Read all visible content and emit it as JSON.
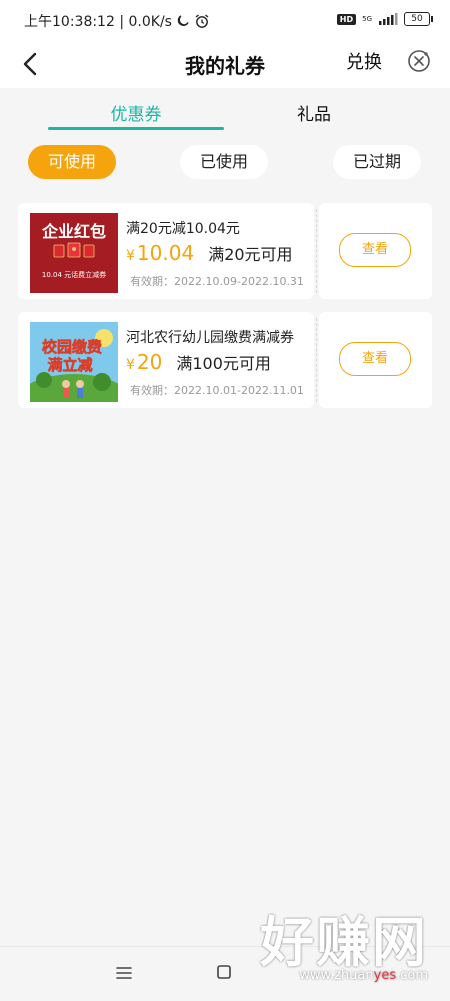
{
  "status_bar": {
    "time_speed": "上午10:38:12 | 0.0K/s",
    "hd": "HD",
    "network": "5G",
    "battery": "50"
  },
  "header": {
    "title": "我的礼券",
    "exchange_label": "兑换"
  },
  "tabs": [
    {
      "label": "优惠券",
      "active": true
    },
    {
      "label": "礼品",
      "active": false
    }
  ],
  "filters": [
    {
      "label": "可使用",
      "active": true
    },
    {
      "label": "已使用",
      "active": false
    },
    {
      "label": "已过期",
      "active": false
    }
  ],
  "coupons": [
    {
      "title": "满20元减10.04元",
      "currency": "¥",
      "amount": "10.04",
      "condition": "满20元可用",
      "validity": "有效期：2022.10.09-2022.10.31",
      "image": {
        "heading": "企业红包",
        "caption": "10.04 元话费立减券",
        "bg_color": "#a51d22"
      },
      "button_label": "查看"
    },
    {
      "title": "河北农行幼儿园缴费满减券",
      "currency": "¥",
      "amount": "20",
      "condition": "满100元可用",
      "validity": "有效期：2022.10.01-2022.11.01",
      "image": {
        "line1": "校园缴费",
        "line2": "满立减"
      },
      "button_label": "查看"
    }
  ],
  "watermark": {
    "brand": "好赚网",
    "url_prefix": "www.zhuan",
    "url_highlight": "yes",
    "url_suffix": ".com"
  },
  "colors": {
    "accent_teal": "#1ab7a2",
    "accent_orange": "#f6a40d",
    "background": "#f5f5f5"
  }
}
